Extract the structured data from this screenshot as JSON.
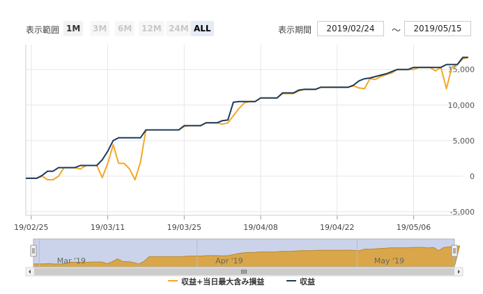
{
  "toolbar": {
    "range_label": "表示範囲",
    "range_buttons": [
      {
        "label": "1M",
        "state": "enabled"
      },
      {
        "label": "3M",
        "state": "disabled"
      },
      {
        "label": "6M",
        "state": "disabled"
      },
      {
        "label": "12M",
        "state": "disabled"
      },
      {
        "label": "24M",
        "state": "disabled"
      },
      {
        "label": "ALL",
        "state": "selected"
      }
    ],
    "period_label": "表示期間",
    "from_date": "2019/02/24",
    "tilde": "～",
    "to_date": "2019/05/15"
  },
  "colors": {
    "series_profit_with_loss": "#f5a623",
    "series_profit": "#1b3a5c",
    "navigator_fill": "#d9a74a",
    "navigator_mask": "#cbd3ea",
    "grid": "#e6e6e6"
  },
  "navigator": {
    "labels": [
      "Mar '19",
      "Apr '19",
      "May '19"
    ]
  },
  "chart_data": {
    "type": "line",
    "xlabel": "",
    "ylabel": "",
    "y_axis_position": "right",
    "ylim": [
      -5500,
      18500
    ],
    "y_ticks": [
      -5000,
      0,
      5000,
      10000,
      15000
    ],
    "y_tick_labels": [
      "-5,000",
      "0",
      "5,000",
      "10,000",
      "15,000"
    ],
    "x_tick_labels": [
      "19/02/25",
      "19/03/11",
      "19/03/25",
      "19/04/08",
      "19/04/22",
      "19/05/06"
    ],
    "x_tick_index": [
      1,
      15,
      29,
      43,
      57,
      71
    ],
    "x": [
      "2019/02/24",
      "2019/02/25",
      "2019/02/26",
      "2019/02/27",
      "2019/02/28",
      "2019/03/01",
      "2019/03/02",
      "2019/03/03",
      "2019/03/04",
      "2019/03/05",
      "2019/03/06",
      "2019/03/07",
      "2019/03/08",
      "2019/03/09",
      "2019/03/10",
      "2019/03/11",
      "2019/03/12",
      "2019/03/13",
      "2019/03/14",
      "2019/03/15",
      "2019/03/16",
      "2019/03/17",
      "2019/03/18",
      "2019/03/19",
      "2019/03/20",
      "2019/03/21",
      "2019/03/22",
      "2019/03/23",
      "2019/03/24",
      "2019/03/25",
      "2019/03/26",
      "2019/03/27",
      "2019/03/28",
      "2019/03/29",
      "2019/03/30",
      "2019/03/31",
      "2019/04/01",
      "2019/04/02",
      "2019/04/03",
      "2019/04/04",
      "2019/04/05",
      "2019/04/06",
      "2019/04/07",
      "2019/04/08",
      "2019/04/09",
      "2019/04/10",
      "2019/04/11",
      "2019/04/12",
      "2019/04/13",
      "2019/04/14",
      "2019/04/15",
      "2019/04/16",
      "2019/04/17",
      "2019/04/18",
      "2019/04/19",
      "2019/04/20",
      "2019/04/21",
      "2019/04/22",
      "2019/04/23",
      "2019/04/24",
      "2019/04/25",
      "2019/04/26",
      "2019/04/27",
      "2019/04/28",
      "2019/04/29",
      "2019/04/30",
      "2019/05/01",
      "2019/05/02",
      "2019/05/03",
      "2019/05/04",
      "2019/05/05",
      "2019/05/06",
      "2019/05/07",
      "2019/05/08",
      "2019/05/09",
      "2019/05/10",
      "2019/05/11",
      "2019/05/12",
      "2019/05/13",
      "2019/05/14",
      "2019/05/15"
    ],
    "series": [
      {
        "name": "収益+当日最大含み損益",
        "values": [
          -300,
          -300,
          -300,
          0,
          -500,
          -500,
          0,
          1200,
          1200,
          1200,
          1000,
          1500,
          1500,
          1500,
          -200,
          1800,
          4400,
          1800,
          1800,
          1000,
          -500,
          2000,
          6500,
          6500,
          6500,
          6500,
          6500,
          6500,
          6500,
          7000,
          7100,
          7100,
          7100,
          7500,
          7500,
          7500,
          7300,
          7500,
          8500,
          9500,
          10300,
          10500,
          10500,
          11000,
          11000,
          11000,
          11000,
          11600,
          11600,
          11600,
          12000,
          12200,
          12200,
          12200,
          12500,
          12500,
          12500,
          12500,
          12500,
          12500,
          12700,
          12400,
          12300,
          13700,
          13600,
          14000,
          14300,
          14500,
          15000,
          15000,
          15000,
          15000,
          15300,
          15300,
          15300,
          14800,
          15300,
          12300,
          15300,
          15700,
          16500,
          16700
        ]
      },
      {
        "name": "収益",
        "values": [
          -300,
          -300,
          -300,
          100,
          700,
          700,
          1200,
          1200,
          1200,
          1200,
          1500,
          1500,
          1500,
          1500,
          2300,
          3500,
          5000,
          5400,
          5400,
          5400,
          5400,
          5400,
          6500,
          6500,
          6500,
          6500,
          6500,
          6500,
          6500,
          7100,
          7100,
          7100,
          7100,
          7500,
          7500,
          7500,
          7800,
          7900,
          10400,
          10500,
          10500,
          10500,
          10500,
          11000,
          11000,
          11000,
          11000,
          11700,
          11700,
          11700,
          12100,
          12200,
          12200,
          12200,
          12500,
          12500,
          12500,
          12500,
          12500,
          12500,
          12800,
          13400,
          13700,
          13800,
          14000,
          14200,
          14400,
          14700,
          15000,
          15000,
          15000,
          15300,
          15300,
          15300,
          15300,
          15300,
          15300,
          15700,
          15700,
          15700,
          16700,
          16700
        ]
      }
    ]
  }
}
